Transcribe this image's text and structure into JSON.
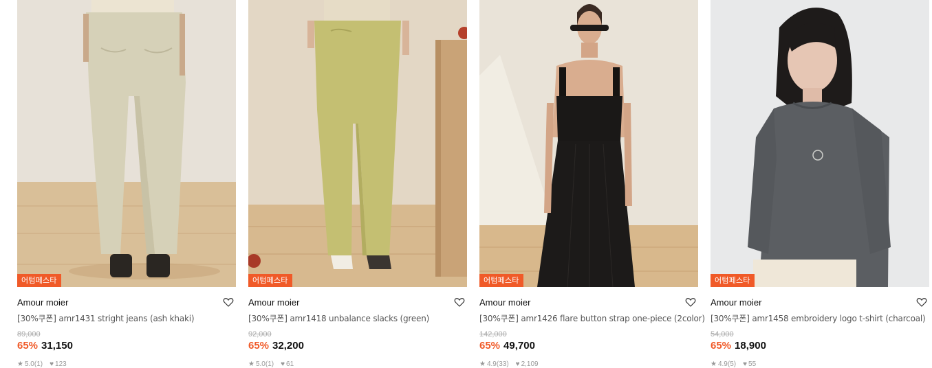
{
  "products": [
    {
      "badge": "어텀페스타",
      "brand": "Amour moier",
      "name": "[30%쿠폰] amr1431 stright jeans (ash khaki)",
      "original_price": "89,000",
      "discount": "65%",
      "price": "31,150",
      "rating": "5.0(1)",
      "likes": "123"
    },
    {
      "badge": "어텀페스타",
      "brand": "Amour moier",
      "name": "[30%쿠폰] amr1418 unbalance slacks (green)",
      "original_price": "92,000",
      "discount": "65%",
      "price": "32,200",
      "rating": "5.0(1)",
      "likes": "61"
    },
    {
      "badge": "어텀페스타",
      "brand": "Amour moier",
      "name": "[30%쿠폰] amr1426 flare button strap one-piece (2color)",
      "original_price": "142,000",
      "discount": "65%",
      "price": "49,700",
      "rating": "4.9(33)",
      "likes": "2,109"
    },
    {
      "badge": "어텀페스타",
      "brand": "Amour moier",
      "name": "[30%쿠폰] amr1458 embroidery logo t-shirt (charcoal)",
      "original_price": "54,000",
      "discount": "65%",
      "price": "18,900",
      "rating": "4.9(5)",
      "likes": "55"
    }
  ],
  "colors": {
    "accent": "#f05a28",
    "text": "#111111",
    "muted": "#aaaaaa"
  },
  "icons": {
    "wishlist": "heart-outline-icon",
    "rating": "star-icon",
    "likes": "heart-small-icon"
  }
}
